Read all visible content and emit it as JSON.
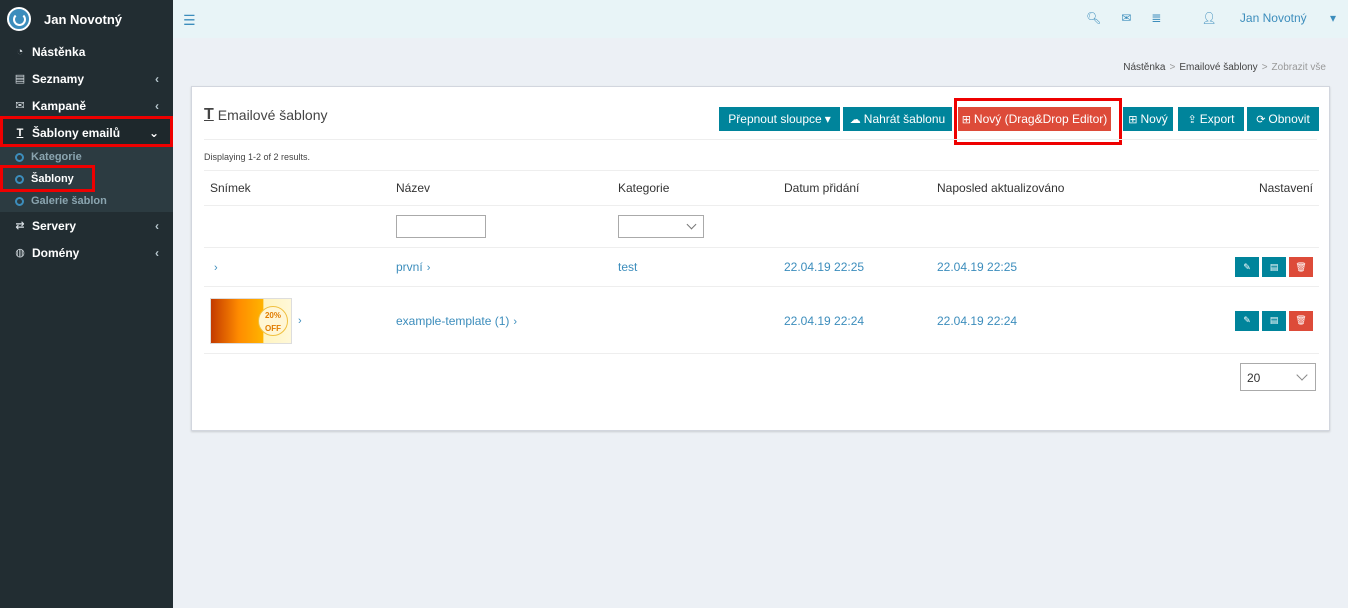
{
  "app": {
    "user": "Jan Novotný"
  },
  "sidebar": {
    "items": [
      {
        "label": "Nástěnka",
        "icon": "dashboard-icon"
      },
      {
        "label": "Seznamy",
        "icon": "list-icon"
      },
      {
        "label": "Kampaně",
        "icon": "envelope-icon"
      },
      {
        "label": "Šablony emailů",
        "icon": "text-template-icon"
      },
      {
        "label": "Servery",
        "icon": "exchange-icon"
      },
      {
        "label": "Domény",
        "icon": "globe-icon"
      }
    ],
    "subitems": [
      {
        "label": "Kategorie"
      },
      {
        "label": "Šablony"
      },
      {
        "label": "Galerie šablon"
      }
    ]
  },
  "topbar": {
    "user_label": "Jan Novotný"
  },
  "breadcrumb": {
    "home": "Nástěnka",
    "section": "Emailové šablony",
    "current": "Zobrazit vše"
  },
  "box": {
    "title": "Emailové šablony",
    "buttons": {
      "switch_columns": "Přepnout sloupce",
      "upload": "Nahrát šablonu",
      "new_dnd": "Nový (Drag&Drop Editor)",
      "new": "Nový",
      "export": "Export",
      "refresh": "Obnovit"
    },
    "summary": "Displaying 1-2 of 2 results."
  },
  "table": {
    "headers": [
      "Snímek",
      "Název",
      "Kategorie",
      "Datum přidání",
      "Naposled aktualizováno",
      "Nastavení"
    ],
    "rows": [
      {
        "name": "první",
        "category": "test",
        "added": "22.04.19 22:25",
        "updated": "22.04.19 22:25"
      },
      {
        "name": "example-template (1)",
        "category": "",
        "added": "22.04.19 22:24",
        "updated": "22.04.19 22:24",
        "thumb_text": "20% OFF"
      }
    ]
  },
  "pager": {
    "page_size": "20"
  },
  "colors": {
    "accent": "#00849b",
    "danger": "#dd4b39",
    "sidebar": "#222d32",
    "highlight": "#ee0000"
  }
}
